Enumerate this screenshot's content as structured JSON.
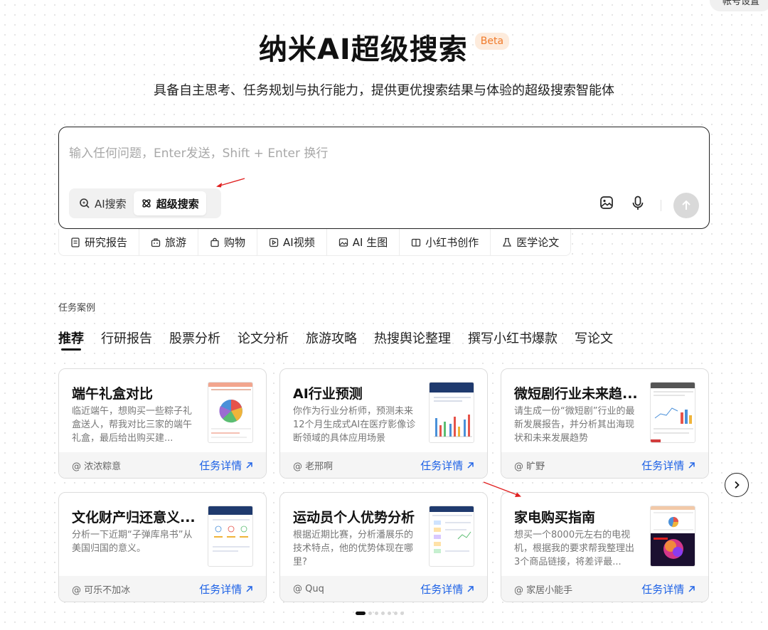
{
  "corner_button": "帐号设置",
  "hero": {
    "title": "纳米AI超级搜索",
    "badge": "Beta",
    "subtitle": "具备自主思考、任务规划与执行能力，提供更优搜索结果与体验的超级搜索智能体"
  },
  "search": {
    "placeholder": "输入任何问题，Enter发送，Shift + Enter 换行",
    "value": "",
    "modes": [
      {
        "label": "AI搜索",
        "icon": "ai-search-icon",
        "active": false
      },
      {
        "label": "超级搜索",
        "icon": "atom-icon",
        "active": true
      }
    ],
    "tools": [
      "image-upload-icon",
      "microphone-icon"
    ],
    "send_icon": "arrow-up-icon"
  },
  "quick_actions": [
    {
      "label": "研究报告",
      "icon": "document-icon"
    },
    {
      "label": "旅游",
      "icon": "luggage-icon"
    },
    {
      "label": "购物",
      "icon": "shopping-bag-icon"
    },
    {
      "label": "AI视频",
      "icon": "video-icon"
    },
    {
      "label": "AI 生图",
      "icon": "image-icon"
    },
    {
      "label": "小红书创作",
      "icon": "book-icon"
    },
    {
      "label": "医学论文",
      "icon": "flask-icon"
    }
  ],
  "cases": {
    "label": "任务案例",
    "tabs": [
      "推荐",
      "行研报告",
      "股票分析",
      "论文分析",
      "旅游攻略",
      "热搜舆论整理",
      "撰写小红书爆款",
      "写论文"
    ],
    "active_tab": 0,
    "detail_label": "任务详情",
    "cards": [
      {
        "title": "端午礼盒对比",
        "desc": "临近端午，想购买一些粽子礼盒送人，帮我对比三家的端午礼盒，最后给出购买建...",
        "author": "@ 浓浓粽意"
      },
      {
        "title": "AI行业预测",
        "desc": "你作为行业分析师，预测未来12个月生成式AI在医疗影像诊断领域的具体应用场景",
        "author": "@ 老邢啊"
      },
      {
        "title": "微短剧行业未来趋...",
        "desc": "请生成一份“微短剧”行业的最新发展报告，并分析其出海现状和未来发展趋势",
        "author": "@ 旷野"
      },
      {
        "title": "文化财产归还意义...",
        "desc": "分析一下近期“子弹库帛书”从美国归国的意义。",
        "author": "@ 可乐不加冰"
      },
      {
        "title": "运动员个人优势分析",
        "desc": "根据近期比赛，分析潘展乐的技术特点，他的优势体现在哪里?",
        "author": "@ Quq"
      },
      {
        "title": "家电购买指南",
        "desc": "想买一个8000元左右的电视机，根据我的要求帮我整理出3个商品链接，将差评最...",
        "author": "@ 家居小能手"
      }
    ]
  },
  "pagination": {
    "pages": 7,
    "current": 1
  },
  "colors": {
    "accent_blue": "#1e62e6",
    "beta_orange": "#f07a2a",
    "annotation_red": "#e02020"
  }
}
